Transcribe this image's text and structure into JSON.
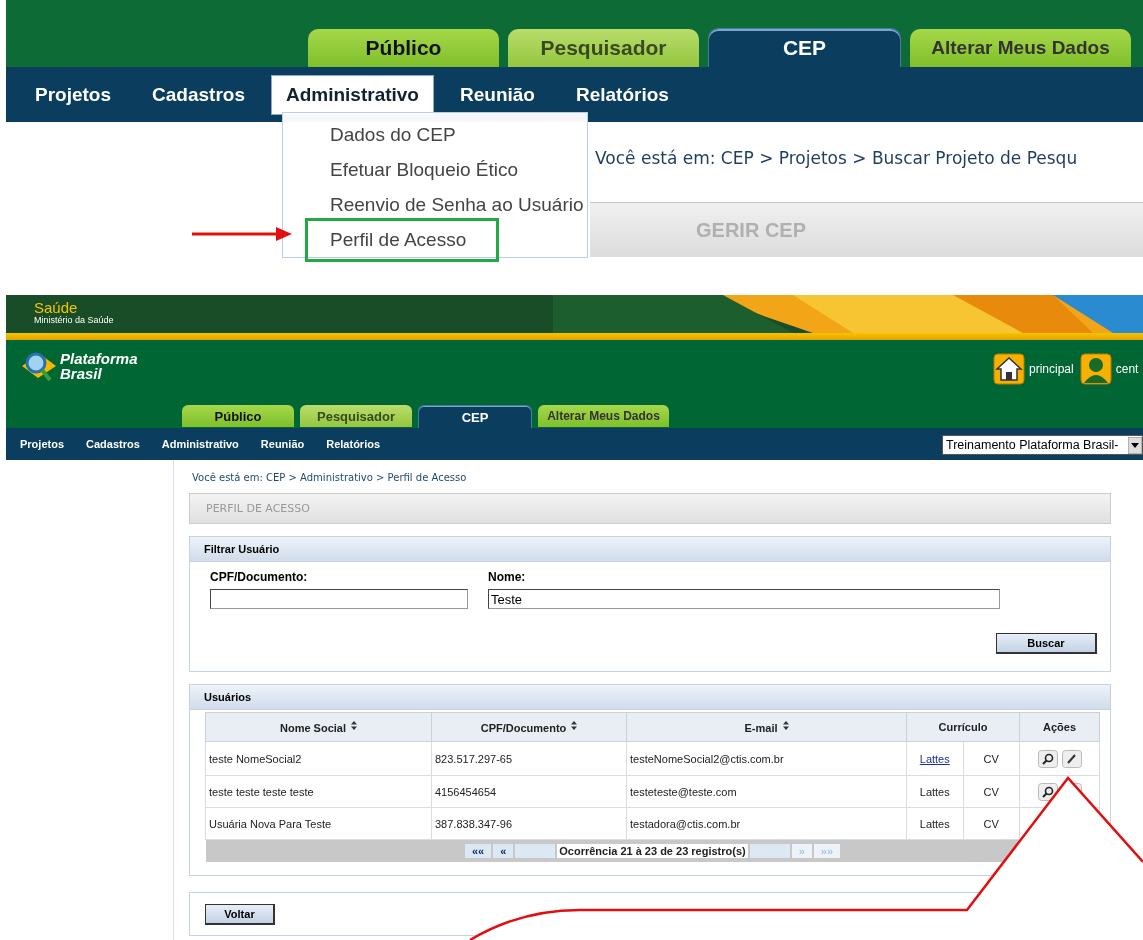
{
  "top_screen": {
    "tabs": [
      {
        "label": "Público",
        "selected": false,
        "kind": "lime"
      },
      {
        "label": "Pesquisador",
        "selected": false,
        "kind": "pale"
      },
      {
        "label": "CEP",
        "selected": true,
        "kind": "blue"
      },
      {
        "label": "Alterar Meus Dados",
        "selected": false,
        "kind": "lime"
      }
    ],
    "nav": [
      {
        "label": "Projetos",
        "selected": false
      },
      {
        "label": "Cadastros",
        "selected": false
      },
      {
        "label": "Administrativo",
        "selected": true
      },
      {
        "label": "Reunião",
        "selected": false
      },
      {
        "label": "Relatórios",
        "selected": false
      }
    ],
    "menu": [
      {
        "label": "Dados do CEP",
        "highlighted": false
      },
      {
        "label": "Efetuar Bloqueio Ético",
        "highlighted": false
      },
      {
        "label": "Reenvio de Senha ao Usuário",
        "highlighted": false
      },
      {
        "label": "Perfil de Acesso",
        "highlighted": true
      }
    ],
    "breadcrumb": "Você está em: CEP > Projetos > Buscar Projeto de Pesqu",
    "section_title": "GERIR CEP"
  },
  "bottom_screen": {
    "banner": {
      "title": "Saúde",
      "subtitle": "Ministério da Saúde"
    },
    "logo": {
      "line1": "Plataforma",
      "line2": "Brasil"
    },
    "header_links": [
      "principal",
      "cent"
    ],
    "tabs": [
      {
        "label": "Público",
        "selected": false,
        "kind": "lime"
      },
      {
        "label": "Pesquisador",
        "selected": false,
        "kind": "pale"
      },
      {
        "label": "CEP",
        "selected": true,
        "kind": "blue"
      },
      {
        "label": "Alterar Meus Dados",
        "selected": false,
        "kind": "lime"
      }
    ],
    "nav": [
      "Projetos",
      "Cadastros",
      "Administrativo",
      "Reunião",
      "Relatórios"
    ],
    "select": {
      "value": "Treinamento Plataforma Brasil-"
    },
    "breadcrumb": "Você está em: CEP > Administrativo > Perfil de Acesso",
    "page_title": "PERFIL DE ACESSO",
    "filter": {
      "title": "Filtrar Usuário",
      "fields": [
        {
          "label": "CPF/Documento:"
        },
        {
          "label": "Nome:",
          "value": "Teste"
        }
      ],
      "button": "Buscar"
    },
    "users": {
      "title": "Usuários",
      "columns": [
        "Nome Social",
        "CPF/Documento",
        "E-mail",
        "Currículo",
        "Ações"
      ],
      "rows": [
        {
          "name": "teste NomeSocial2",
          "cpf": "823.517.297-65",
          "email": "testeNomeSocial2@ctis.com.br",
          "lattes": "Lattes",
          "lattes_link": true,
          "cv": "CV",
          "actions_visible": true
        },
        {
          "name": "teste teste teste teste",
          "cpf": "4156454654",
          "email": "testeteste@teste.com",
          "lattes": "Lattes",
          "lattes_link": false,
          "cv": "CV",
          "actions_visible": true
        },
        {
          "name": "Usuária Nova Para Teste",
          "cpf": "387.838.347-96",
          "email": "testadora@ctis.com.br",
          "lattes": "Lattes",
          "lattes_link": false,
          "cv": "CV",
          "actions_visible": false
        }
      ],
      "pager": {
        "first": "««",
        "prev": "«",
        "text": "Ocorrência 21 à 23 de 23 registro(s)",
        "next": "»",
        "last": "»»",
        "next_disabled": true
      }
    },
    "back_button": "Voltar"
  }
}
